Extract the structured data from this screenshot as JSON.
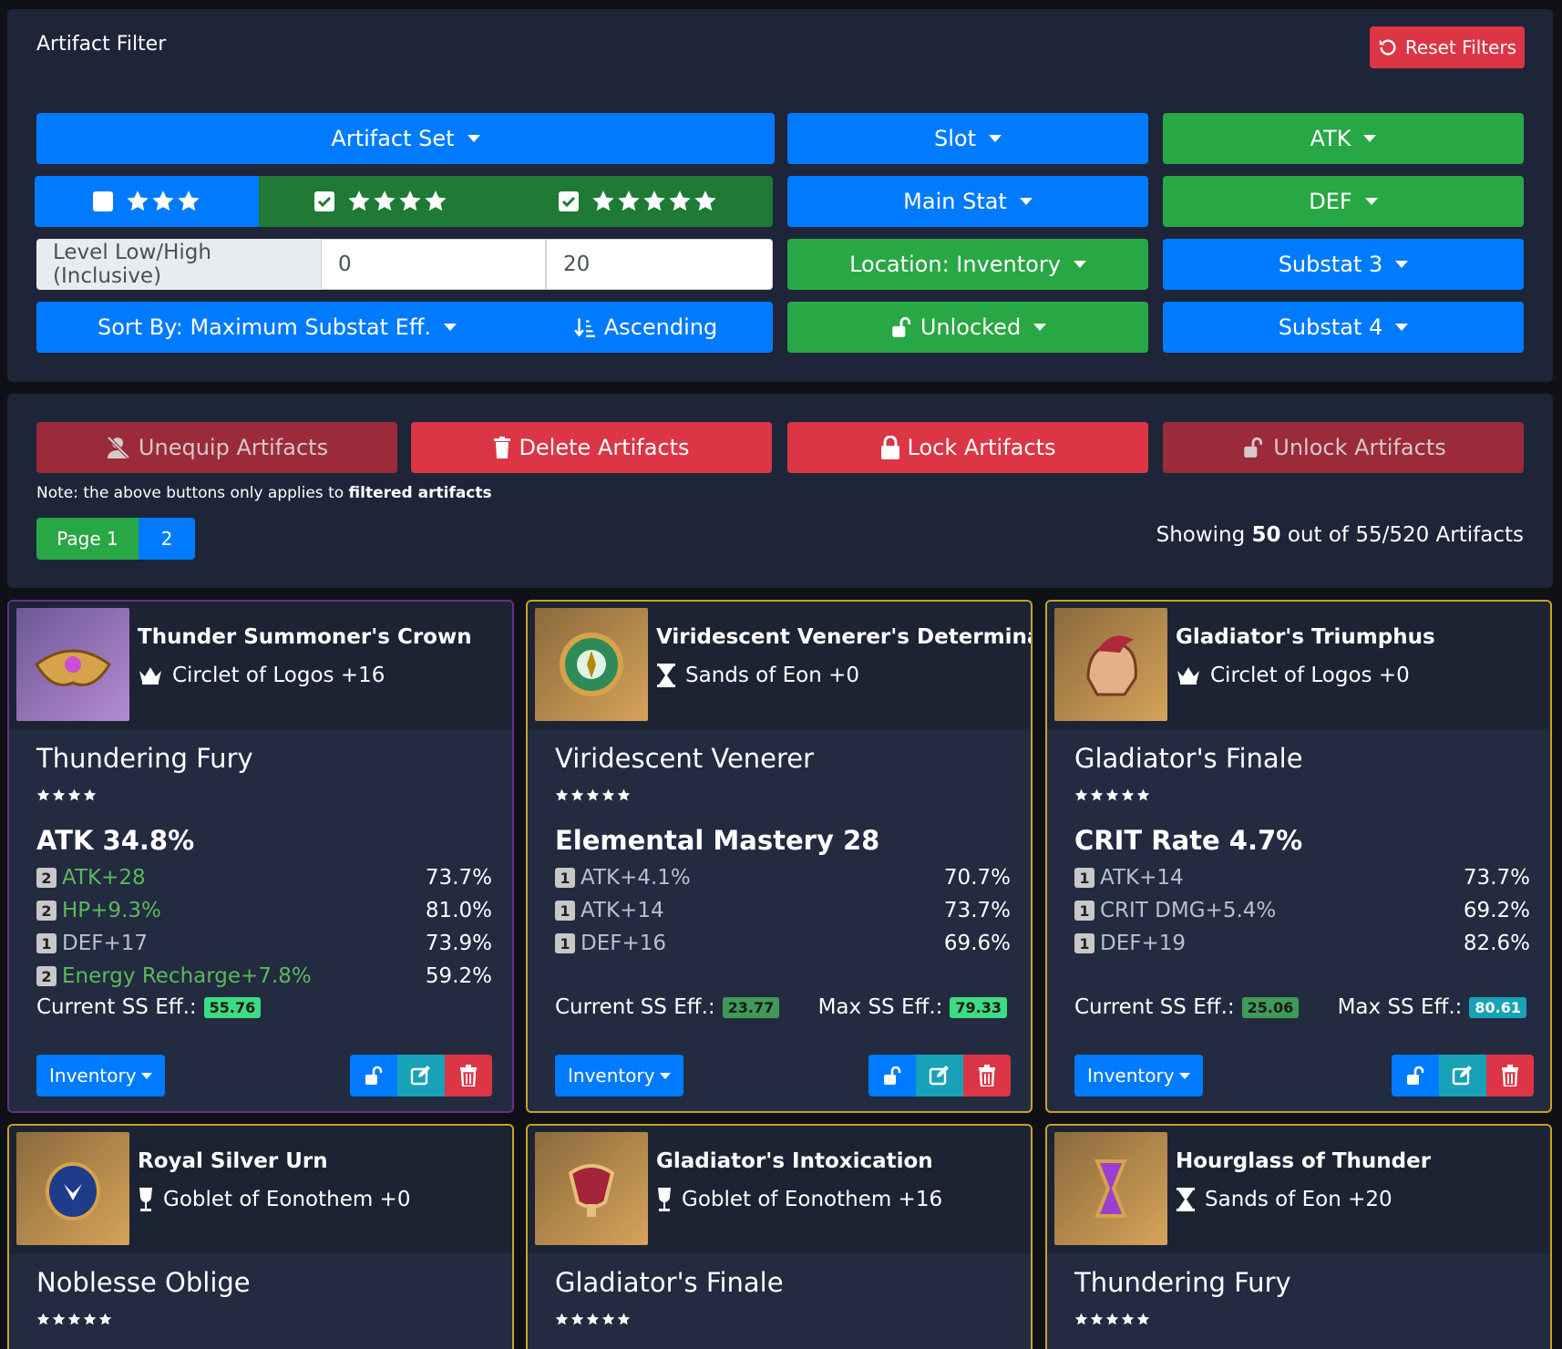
{
  "filter": {
    "title": "Artifact Filter",
    "reset_label": "Reset Filters",
    "artifact_set_label": "Artifact Set",
    "slot_label": "Slot",
    "atk_label": "ATK",
    "main_stat_label": "Main Stat",
    "def_label": "DEF",
    "location_label": "Location: Inventory",
    "substat3_label": "Substat 3",
    "unlocked_label": "Unlocked",
    "substat4_label": "Substat 4",
    "level_label": "Level Low/High (Inclusive)",
    "level_low": "0",
    "level_high": "20",
    "sort_label": "Sort By: Maximum Substat Eff.",
    "order_label": "Ascending",
    "rarity_filters": [
      {
        "stars": 3,
        "checked": false
      },
      {
        "stars": 4,
        "checked": true
      },
      {
        "stars": 5,
        "checked": true
      }
    ]
  },
  "actions": {
    "unequip_label": "Unequip Artifacts",
    "delete_label": "Delete Artifacts",
    "lock_label": "Lock Artifacts",
    "unlock_label": "Unlock Artifacts",
    "note_prefix": "Note: the above buttons only applies to",
    "note_bold": "filtered artifacts",
    "page_label": "Page 1",
    "page2_label": "2",
    "showing_prefix": "Showing",
    "showing_count": "50",
    "showing_suffix": "out of 55/520 Artifacts"
  },
  "cards": [
    {
      "name": "Thunder Summoner's Crown",
      "slot": "Circlet of Logos +16",
      "set": "Thundering Fury",
      "rarity": 4,
      "main": "ATK 34.8%",
      "substats": [
        {
          "rolls": "2",
          "name": "ATK+28",
          "value": "73.7%",
          "highlight": true
        },
        {
          "rolls": "2",
          "name": "HP+9.3%",
          "value": "81.0%",
          "highlight": true
        },
        {
          "rolls": "1",
          "name": "DEF+17",
          "value": "73.9%",
          "highlight": false
        },
        {
          "rolls": "2",
          "name": "Energy Recharge+7.8%",
          "value": "59.2%",
          "highlight": true
        }
      ],
      "current_label": "Current SS Eff.:",
      "current_value": "55.76",
      "location": "Inventory"
    },
    {
      "name": "Viridescent Venerer's Determination",
      "slot": "Sands of Eon +0",
      "set": "Viridescent Venerer",
      "rarity": 5,
      "main": "Elemental Mastery 28",
      "substats": [
        {
          "rolls": "1",
          "name": "ATK+4.1%",
          "value": "70.7%",
          "highlight": false
        },
        {
          "rolls": "1",
          "name": "ATK+14",
          "value": "73.7%",
          "highlight": false
        },
        {
          "rolls": "1",
          "name": "DEF+16",
          "value": "69.6%",
          "highlight": false
        }
      ],
      "current_label": "Current SS Eff.:",
      "current_value": "23.77",
      "max_label": "Max SS Eff.:",
      "max_value": "79.33",
      "location": "Inventory"
    },
    {
      "name": "Gladiator's Triumphus",
      "slot": "Circlet of Logos +0",
      "set": "Gladiator's Finale",
      "rarity": 5,
      "main": "CRIT Rate 4.7%",
      "substats": [
        {
          "rolls": "1",
          "name": "ATK+14",
          "value": "73.7%",
          "highlight": false
        },
        {
          "rolls": "1",
          "name": "CRIT DMG+5.4%",
          "value": "69.2%",
          "highlight": false
        },
        {
          "rolls": "1",
          "name": "DEF+19",
          "value": "82.6%",
          "highlight": false
        }
      ],
      "current_label": "Current SS Eff.:",
      "current_value": "25.06",
      "max_label": "Max SS Eff.:",
      "max_value": "80.61",
      "location": "Inventory"
    },
    {
      "name": "Royal Silver Urn",
      "slot": "Goblet of Eonothem +0",
      "set": "Noblesse Oblige",
      "rarity": 5
    },
    {
      "name": "Gladiator's Intoxication",
      "slot": "Goblet of Eonothem +16",
      "set": "Gladiator's Finale",
      "rarity": 5
    },
    {
      "name": "Hourglass of Thunder",
      "slot": "Sands of Eon +20",
      "set": "Thundering Fury",
      "rarity": 5
    }
  ],
  "colors": {
    "blue": "#007bff",
    "green": "#28a745",
    "red": "#dc3545",
    "current_badge": "#3f9a5a",
    "max_badge_green": "#3ddc84",
    "max_badge_cyan": "#17a2b8"
  }
}
